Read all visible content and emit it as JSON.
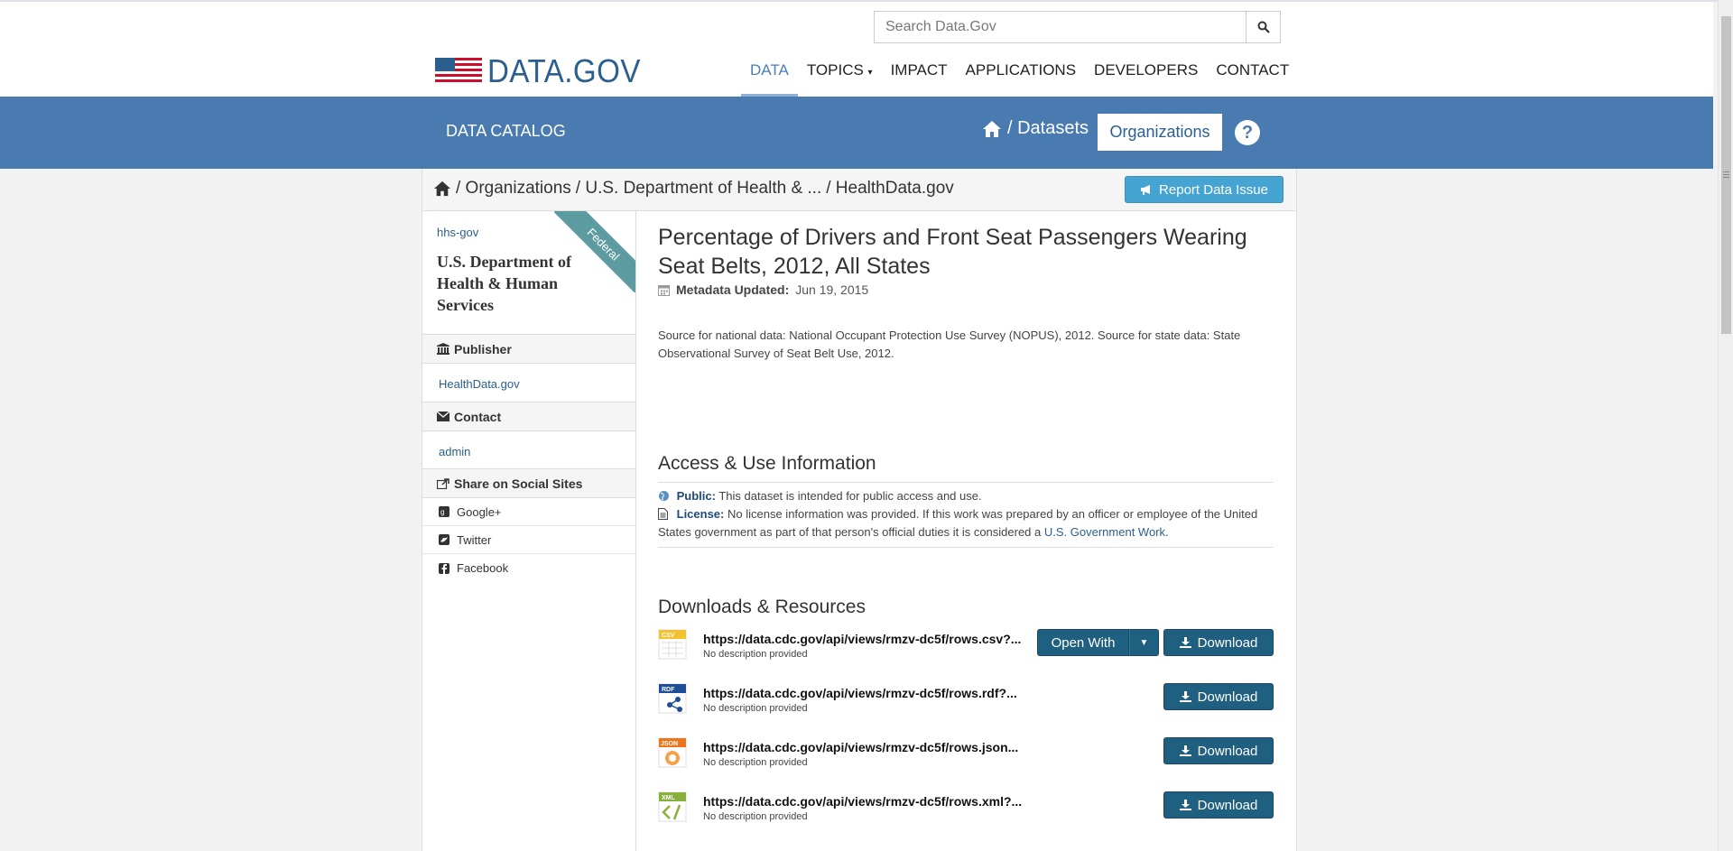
{
  "search": {
    "placeholder": "Search Data.Gov"
  },
  "logo": {
    "name": "DATA.GOV"
  },
  "nav": {
    "data": "DATA",
    "topics": "TOPICS",
    "impact": "IMPACT",
    "applications": "APPLICATIONS",
    "developers": "DEVELOPERS",
    "contact": "CONTACT"
  },
  "bluebar": {
    "catalog": "DATA CATALOG",
    "datasets": "/ Datasets",
    "organizations": "Organizations",
    "help": "?"
  },
  "breadcrumb": {
    "organizations": "/ Organizations",
    "department": "/ U.S. Department of Health & ...",
    "current": "/  HealthData.gov"
  },
  "report_label": "Report Data Issue",
  "sidebar": {
    "ribbon": "Federal",
    "slug": "hhs-gov",
    "org_name": "U.S. Department of Health & Human Services",
    "publisher_heading": "Publisher",
    "publisher_value": "HealthData.gov",
    "contact_heading": "Contact",
    "contact_value": "admin",
    "share_heading": "Share on Social Sites",
    "social": [
      "Google+",
      "Twitter",
      "Facebook"
    ]
  },
  "dataset": {
    "title": "Percentage of Drivers and Front Seat Passengers Wearing Seat Belts, 2012, All States",
    "meta_label": "Metadata Updated:",
    "meta_date": "Jun 19, 2015",
    "description": "Source for national data: National Occupant Protection Use Survey (NOPUS), 2012. Source for state data: State Observational Survey of Seat Belt Use, 2012."
  },
  "access": {
    "heading": "Access & Use Information",
    "public_label": "Public:",
    "public_text": "This dataset is intended for public access and use.",
    "license_label": "License:",
    "license_text": "No license information was provided. If this work was prepared by an officer or employee of the United States government as part of that person's official duties it is considered a",
    "license_link": "U.S. Government Work",
    "license_end": "."
  },
  "downloads": {
    "heading": "Downloads & Resources",
    "open_with": "Open With",
    "download": "Download",
    "resources": [
      {
        "format": "CSV",
        "url": "https://data.cdc.gov/api/views/rmzv-dc5f/rows.csv?...",
        "desc": "No description provided"
      },
      {
        "format": "RDF",
        "url": "https://data.cdc.gov/api/views/rmzv-dc5f/rows.rdf?...",
        "desc": "No description provided"
      },
      {
        "format": "JSON",
        "url": "https://data.cdc.gov/api/views/rmzv-dc5f/rows.json...",
        "desc": "No description provided"
      },
      {
        "format": "XML",
        "url": "https://data.cdc.gov/api/views/rmzv-dc5f/rows.xml?...",
        "desc": "No description provided"
      }
    ]
  },
  "colors": {
    "brand_blue": "#4a7bb0",
    "dark_button": "#1f5f80",
    "report_button": "#45a4d2",
    "ribbon": "#5c9ca1"
  }
}
